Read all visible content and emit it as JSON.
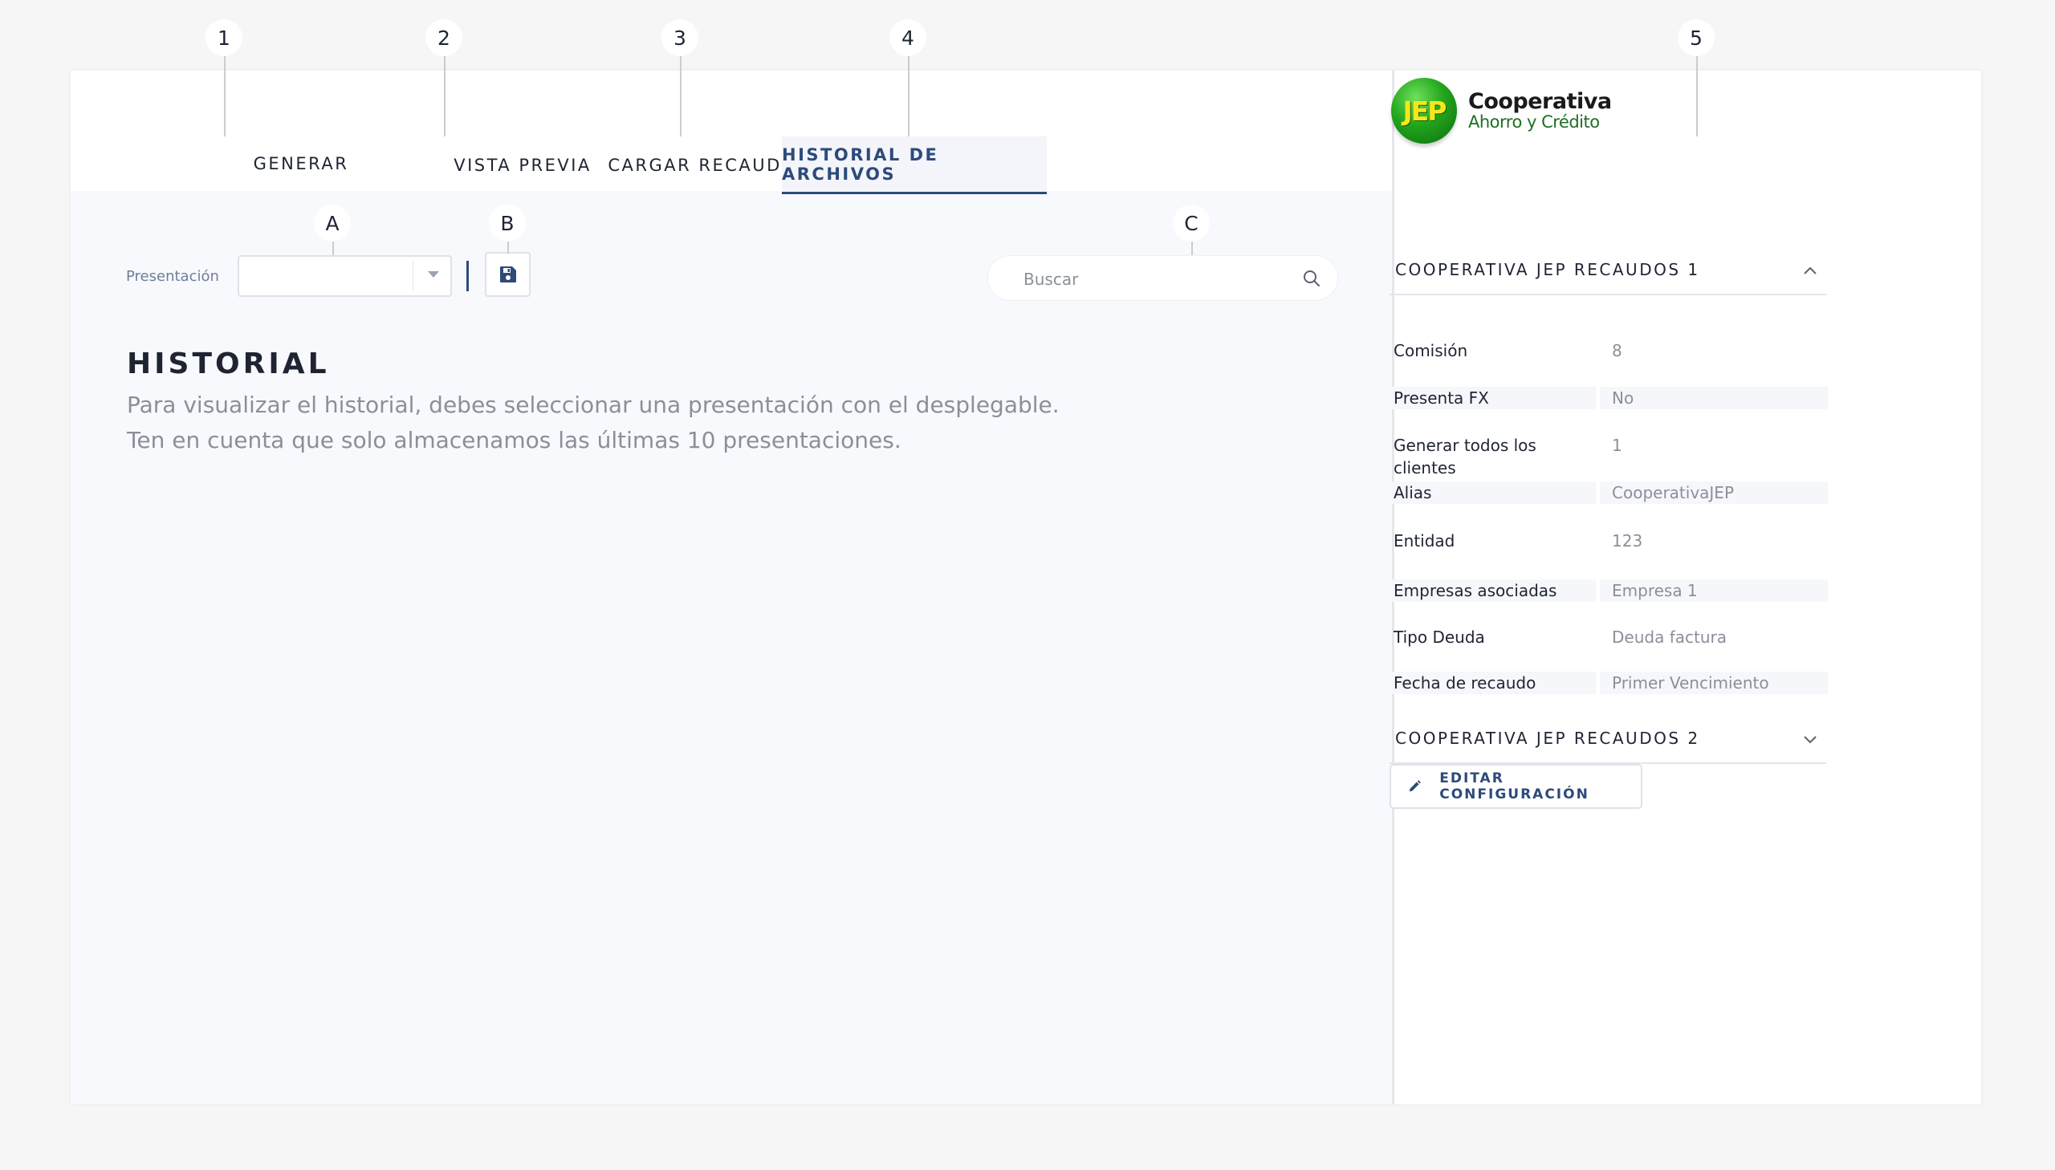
{
  "markers": [
    "1",
    "2",
    "3",
    "4",
    "5",
    "A",
    "B",
    "C"
  ],
  "tabs": [
    {
      "label": "GENERAR"
    },
    {
      "label": "VISTA PREVIA"
    },
    {
      "label": "CARGAR RECAUDOS"
    },
    {
      "label": "HISTORIAL DE ARCHIVOS",
      "active": true
    }
  ],
  "filters": {
    "presentation_label": "Presentación",
    "presentation_value": "",
    "search_placeholder": "Buscar"
  },
  "history": {
    "title": "HISTORIAL",
    "line1": "Para visualizar el historial, debes seleccionar una presentación con el desplegable.",
    "line2": "Ten en cuenta que solo almacenamos las últimas 10 presentaciones."
  },
  "logo": {
    "mark": "JEP",
    "line1": "Cooperativa",
    "line2": "Ahorro y Crédito"
  },
  "sections": [
    {
      "title": "COOPERATIVA JEP RECAUDOS 1",
      "expanded": true
    },
    {
      "title": "COOPERATIVA JEP RECAUDOS 2",
      "expanded": false
    }
  ],
  "properties": [
    {
      "label": "Comisión",
      "value": "8"
    },
    {
      "label": "Presenta FX",
      "value": "No"
    },
    {
      "label": "Generar todos los clientes",
      "value": "1"
    },
    {
      "label": "Alias",
      "value": "CooperativaJEP"
    },
    {
      "label": "Entidad",
      "value": "123"
    },
    {
      "label": "Empresas asociadas",
      "value": "Empresa 1"
    },
    {
      "label": "Tipo Deuda",
      "value": "Deuda factura"
    },
    {
      "label": "Fecha de recaudo",
      "value": "Primer Vencimiento"
    }
  ],
  "actions": {
    "edit_label": "EDITAR CONFIGURACIÓN"
  },
  "icons": {
    "save": "floppy-disk-icon",
    "search": "search-icon",
    "edit": "pencil-icon",
    "collapse": "chevron-up-icon",
    "expand": "chevron-down-icon"
  },
  "colors": {
    "accent": "#2d4a7a",
    "muted_text": "#8a8f99",
    "logo_green": "#22a51c",
    "logo_yellow": "#f5e71c"
  }
}
